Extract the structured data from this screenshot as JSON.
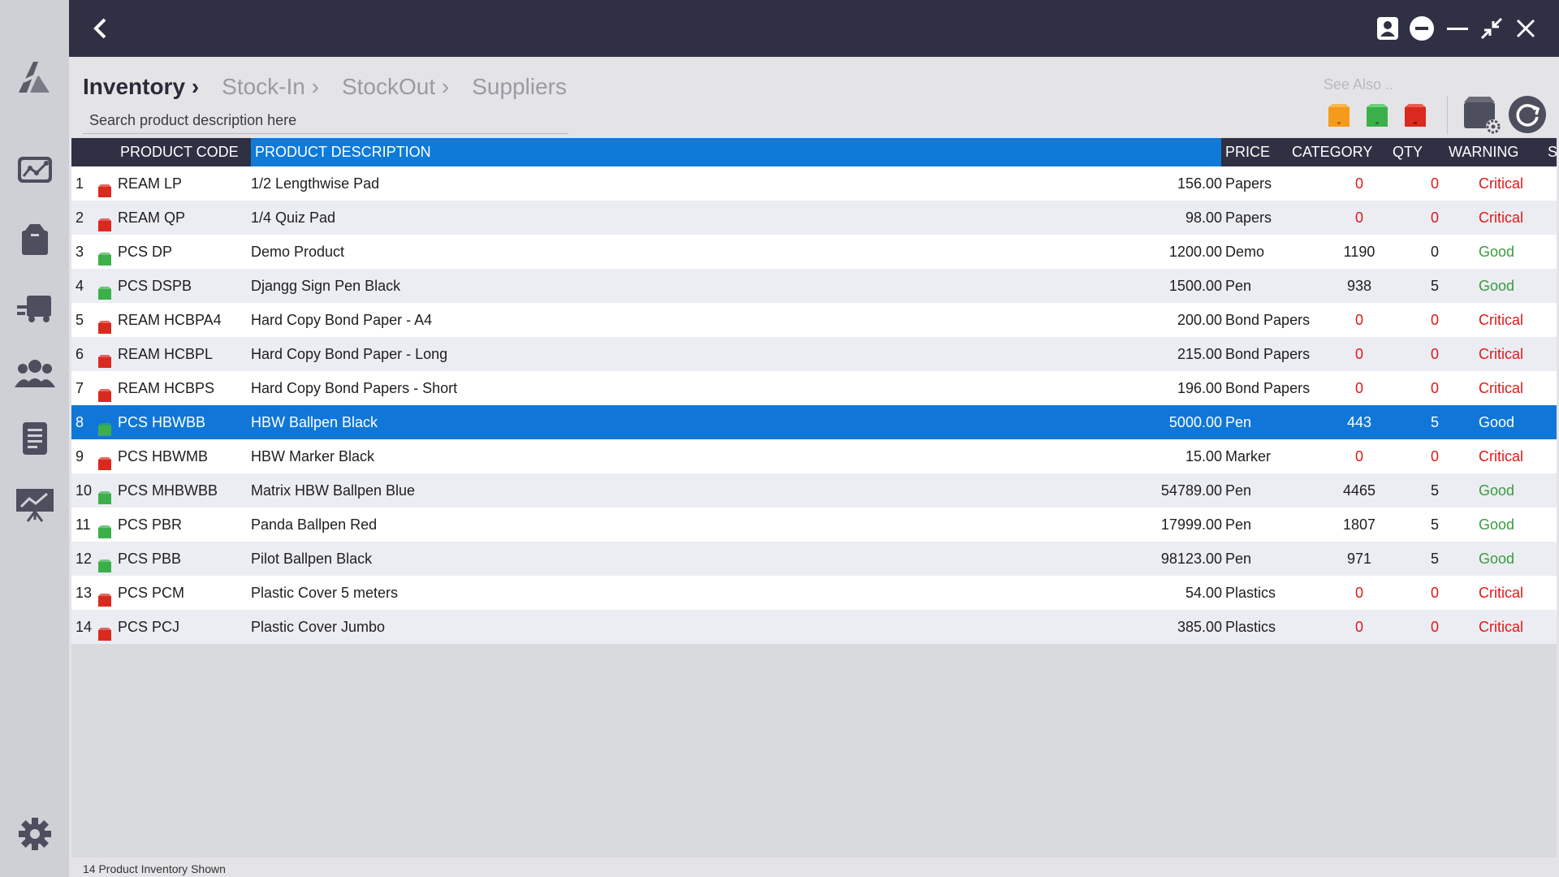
{
  "window": {
    "back_icon": "chevron-left-icon",
    "controls": [
      "account-icon",
      "minus-circle-icon",
      "minimize-icon",
      "restore-icon",
      "close-icon"
    ]
  },
  "sidebar": {
    "logo": "app-logo",
    "items": [
      "dashboard-icon",
      "box-icon",
      "stock-transfer-icon",
      "users-icon",
      "report-icon",
      "chart-board-icon"
    ],
    "settings": "gear-icon"
  },
  "breadcrumbs": [
    {
      "label": "Inventory",
      "sep": "›"
    },
    {
      "label": "Stock-In",
      "sep": "›"
    },
    {
      "label": "StockOut",
      "sep": "›"
    },
    {
      "label": "Suppliers",
      "sep": ""
    }
  ],
  "search": {
    "placeholder": "Search product description here",
    "value": ""
  },
  "see_also": {
    "label": "See Also ..",
    "icons": [
      "orange-box-icon",
      "green-box-icon",
      "red-box-icon"
    ]
  },
  "tools": [
    "box-settings-icon",
    "refresh-icon"
  ],
  "table": {
    "columns": {
      "code": "PRODUCT CODE",
      "desc": "PRODUCT DESCRIPTION",
      "price": "PRICE",
      "category": "CATEGORY",
      "qty": "QTY",
      "warning": "WARNING",
      "status": "STATUS"
    },
    "selected_index": 7,
    "rows": [
      {
        "no": "1",
        "code": "REAM LP",
        "desc": "1/2 Lengthwise Pad",
        "price": "156.00",
        "category": "Papers",
        "qty": "0",
        "warning": "0",
        "status": "Critical"
      },
      {
        "no": "2",
        "code": "REAM QP",
        "desc": "1/4 Quiz Pad",
        "price": "98.00",
        "category": "Papers",
        "qty": "0",
        "warning": "0",
        "status": "Critical"
      },
      {
        "no": "3",
        "code": "PCS DP",
        "desc": "Demo Product",
        "price": "1200.00",
        "category": "Demo",
        "qty": "1190",
        "warning": "0",
        "status": "Good"
      },
      {
        "no": "4",
        "code": "PCS DSPB",
        "desc": "Djangg Sign Pen Black",
        "price": "1500.00",
        "category": "Pen",
        "qty": "938",
        "warning": "5",
        "status": "Good"
      },
      {
        "no": "5",
        "code": "REAM HCBPA4",
        "desc": "Hard Copy Bond Paper - A4",
        "price": "200.00",
        "category": "Bond Papers",
        "qty": "0",
        "warning": "0",
        "status": "Critical"
      },
      {
        "no": "6",
        "code": "REAM HCBPL",
        "desc": "Hard Copy Bond Paper - Long",
        "price": "215.00",
        "category": "Bond Papers",
        "qty": "0",
        "warning": "0",
        "status": "Critical"
      },
      {
        "no": "7",
        "code": "REAM HCBPS",
        "desc": "Hard Copy Bond Papers - Short",
        "price": "196.00",
        "category": "Bond Papers",
        "qty": "0",
        "warning": "0",
        "status": "Critical"
      },
      {
        "no": "8",
        "code": "PCS HBWBB",
        "desc": "HBW Ballpen Black",
        "price": "5000.00",
        "category": "Pen",
        "qty": "443",
        "warning": "5",
        "status": "Good"
      },
      {
        "no": "9",
        "code": "PCS HBWMB",
        "desc": "HBW Marker Black",
        "price": "15.00",
        "category": "Marker",
        "qty": "0",
        "warning": "0",
        "status": "Critical"
      },
      {
        "no": "10",
        "code": "PCS MHBWBB",
        "desc": "Matrix HBW Ballpen Blue",
        "price": "54789.00",
        "category": "Pen",
        "qty": "4465",
        "warning": "5",
        "status": "Good"
      },
      {
        "no": "11",
        "code": "PCS PBR",
        "desc": "Panda Ballpen Red",
        "price": "17999.00",
        "category": "Pen",
        "qty": "1807",
        "warning": "5",
        "status": "Good"
      },
      {
        "no": "12",
        "code": "PCS PBB",
        "desc": "Pilot Ballpen Black",
        "price": "98123.00",
        "category": "Pen",
        "qty": "971",
        "warning": "5",
        "status": "Good"
      },
      {
        "no": "13",
        "code": "PCS PCM",
        "desc": "Plastic Cover 5 meters",
        "price": "54.00",
        "category": "Plastics",
        "qty": "0",
        "warning": "0",
        "status": "Critical"
      },
      {
        "no": "14",
        "code": "PCS PCJ",
        "desc": "Plastic Cover Jumbo",
        "price": "385.00",
        "category": "Plastics",
        "qty": "0",
        "warning": "0",
        "status": "Critical"
      }
    ]
  },
  "status_bar": "14 Product Inventory Shown",
  "colors": {
    "topbar": "#2f3044",
    "selected": "#1077d8",
    "critical": "#e01818",
    "good": "#3a9b3e",
    "green_box": "#3bb04a",
    "red_box": "#d92a1f",
    "orange_box": "#f59a1b"
  }
}
